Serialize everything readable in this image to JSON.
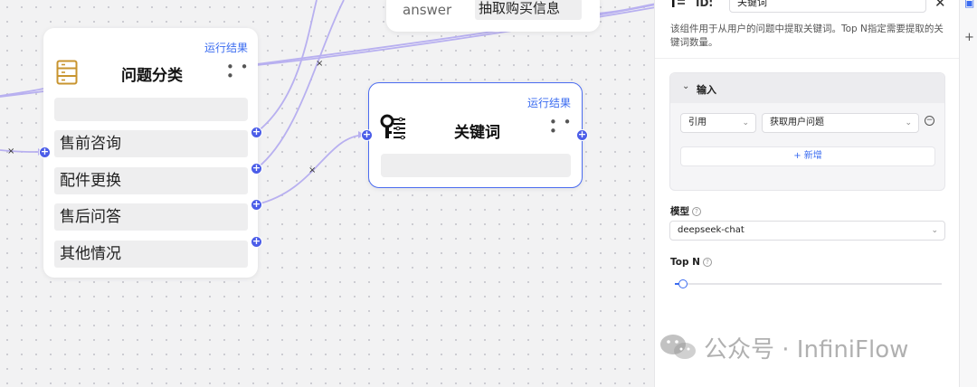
{
  "top_node": {
    "label": "answer",
    "value": "抽取购买信息"
  },
  "category_node": {
    "run_label": "运行结果",
    "title": "问题分类",
    "more": "• • •",
    "categories": [
      "售前咨询",
      "配件更换",
      "售后问答",
      "其他情况"
    ]
  },
  "keyword_node": {
    "run_label": "运行结果",
    "title": "关键词",
    "more": "• • •"
  },
  "edge_marks": {
    "x1": "×",
    "x2": "×",
    "x3": "×"
  },
  "panel": {
    "id_label": "ID:",
    "id_value": "关键词",
    "close": "✕",
    "description": "该组件用于从用户的问题中提取关键词。Top N指定需要提取的关键词数量。",
    "input_section": {
      "title": "输入",
      "ref_label": "引用",
      "ref_value": "获取用户问题",
      "minus": "−",
      "add_label": "+ 新增"
    },
    "model_label": "模型",
    "model_value": "deepseek-chat",
    "topn_label": "Top N",
    "topn_fraction": 0.03
  },
  "watermark": {
    "text": "公众号 · InfiniFlow"
  },
  "colors": {
    "accent": "#3b6cf0",
    "handle": "#4b5de8",
    "edge": "#b8b0f0"
  }
}
